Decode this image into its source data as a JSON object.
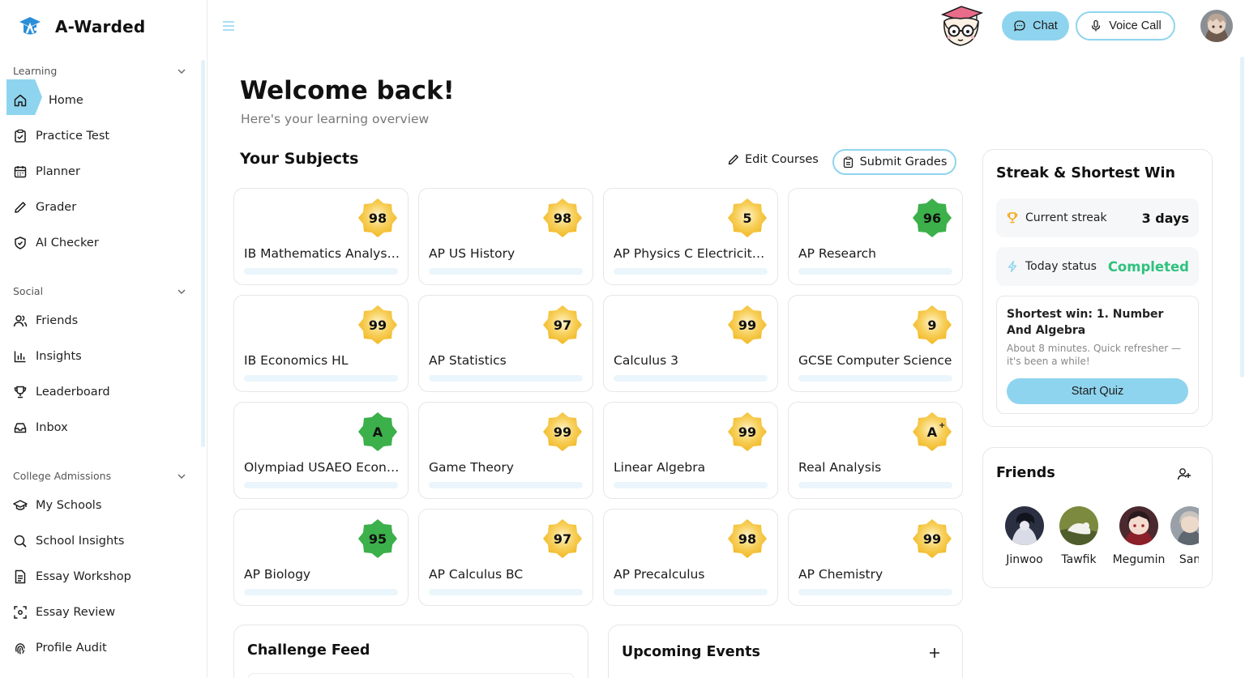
{
  "app": {
    "name": "A-Warded"
  },
  "sidebar": {
    "sections": [
      {
        "title": "Learning",
        "items": [
          {
            "label": "Home",
            "icon": "home-icon",
            "active": true
          },
          {
            "label": "Practice Test",
            "icon": "clipboard-check-icon"
          },
          {
            "label": "Planner",
            "icon": "calendar-icon"
          },
          {
            "label": "Grader",
            "icon": "pencil-icon"
          },
          {
            "label": "AI Checker",
            "icon": "shield-check-icon"
          }
        ]
      },
      {
        "title": "Social",
        "items": [
          {
            "label": "Friends",
            "icon": "users-icon"
          },
          {
            "label": "Insights",
            "icon": "bar-chart-icon"
          },
          {
            "label": "Leaderboard",
            "icon": "trophy-icon"
          },
          {
            "label": "Inbox",
            "icon": "inbox-icon"
          }
        ]
      },
      {
        "title": "College Admissions",
        "items": [
          {
            "label": "My Schools",
            "icon": "graduation-cap-icon"
          },
          {
            "label": "School Insights",
            "icon": "search-icon"
          },
          {
            "label": "Essay Workshop",
            "icon": "document-icon"
          },
          {
            "label": "Essay Review",
            "icon": "scan-text-icon"
          },
          {
            "label": "Profile Audit",
            "icon": "fingerprint-icon"
          }
        ]
      }
    ]
  },
  "topbar": {
    "chat_label": "Chat",
    "voice_label": "Voice Call"
  },
  "welcome": {
    "title": "Welcome back!",
    "subtitle": "Here's your learning overview"
  },
  "subjects": {
    "title": "Your Subjects",
    "edit_label": "Edit Courses",
    "submit_label": "Submit Grades",
    "items": [
      {
        "name": "IB Mathematics Analysis and Approaches HL",
        "grade": "98",
        "color": "gold"
      },
      {
        "name": "AP US History",
        "grade": "98",
        "color": "gold"
      },
      {
        "name": "AP Physics C Electricity and Magnetism",
        "grade": "5",
        "color": "gold"
      },
      {
        "name": "AP Research",
        "grade": "96",
        "color": "green"
      },
      {
        "name": "IB Economics HL",
        "grade": "99",
        "color": "gold"
      },
      {
        "name": "AP Statistics",
        "grade": "97",
        "color": "gold"
      },
      {
        "name": "Calculus 3",
        "grade": "99",
        "color": "gold"
      },
      {
        "name": "GCSE Computer Science",
        "grade": "9",
        "color": "gold"
      },
      {
        "name": "Olympiad USAEO Economics",
        "grade": "A",
        "color": "green"
      },
      {
        "name": "Game Theory",
        "grade": "99",
        "color": "gold"
      },
      {
        "name": "Linear Algebra",
        "grade": "99",
        "color": "gold"
      },
      {
        "name": "Real Analysis",
        "grade": "A",
        "sup": "+",
        "color": "gold"
      },
      {
        "name": "AP Biology",
        "grade": "95",
        "color": "green"
      },
      {
        "name": "AP Calculus BC",
        "grade": "97",
        "color": "gold"
      },
      {
        "name": "AP Precalculus",
        "grade": "98",
        "color": "gold"
      },
      {
        "name": "AP Chemistry",
        "grade": "99",
        "color": "gold"
      }
    ]
  },
  "challenge_feed": {
    "title": "Challenge Feed"
  },
  "upcoming_events": {
    "title": "Upcoming Events",
    "add_label": "+"
  },
  "streak": {
    "title": "Streak & Shortest Win",
    "current_label": "Current streak",
    "current_value": "3 days",
    "today_label": "Today status",
    "today_value": "Completed",
    "win_title": "Shortest win: 1. Number And Algebra",
    "win_desc": "About 8 minutes. Quick refresher — it's been a while!",
    "start_label": "Start Quiz"
  },
  "friends": {
    "title": "Friends",
    "list": [
      {
        "name": "Jinwoo"
      },
      {
        "name": "Tawfik"
      },
      {
        "name": "Megumin"
      },
      {
        "name": "San"
      }
    ]
  },
  "colors": {
    "accent": "#8fd4ee",
    "gold": "#f2b824",
    "green": "#3cb04a",
    "success": "#2ec27e"
  }
}
